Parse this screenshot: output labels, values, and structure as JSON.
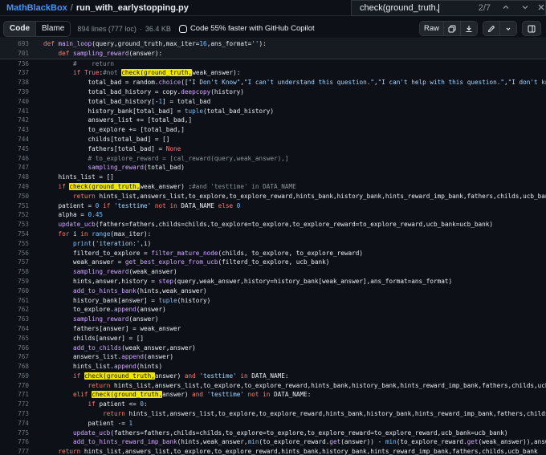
{
  "breadcrumb": {
    "repo": "MathBlackBox",
    "separator": "/",
    "file": "run_with_earlystopping.py"
  },
  "find": {
    "query": "check(ground_truth,",
    "count": "2/7"
  },
  "toolbar": {
    "code_tab": "Code",
    "blame_tab": "Blame",
    "lines_info": "894 lines (777 loc)",
    "dot": "·",
    "size": "36.4 KB",
    "copilot": "Code 55% faster with GitHub Copilot",
    "raw": "Raw"
  },
  "highlight": "check(ground_truth,",
  "sticky": [
    {
      "n": "693",
      "t": "def main_loop(query,ground_truth,max_iter=16,ans_format=''):"
    },
    {
      "n": "701",
      "t": "    def sampling_reward(answer):"
    }
  ],
  "lines": [
    {
      "n": "736",
      "t": "        #    return"
    },
    {
      "n": "737",
      "t": "        if True:#not check(ground_truth,weak_answer):"
    },
    {
      "n": "738",
      "t": "            total_bad = random.choice([\"I Don't Know\",\"I can't understand this question.\",\"I can't help with this question.\",\"I don't know how to solve"
    },
    {
      "n": "739",
      "t": "            total_bad_history = copy.deepcopy(history)"
    },
    {
      "n": "740",
      "t": "            total_bad_history[-1] = total_bad"
    },
    {
      "n": "741",
      "t": "            history_bank[total_bad] = tuple(total_bad_history)"
    },
    {
      "n": "742",
      "t": "            answers_list += [total_bad,]"
    },
    {
      "n": "743",
      "t": "            to_explore += [total_bad,]"
    },
    {
      "n": "744",
      "t": "            childs[total_bad] = []"
    },
    {
      "n": "745",
      "t": "            fathers[total_bad] = None"
    },
    {
      "n": "746",
      "t": "            # to_explore_reward = [cal_reward(query,weak_answer),]"
    },
    {
      "n": "747",
      "t": "            sampling_reward(total_bad)"
    },
    {
      "n": "748",
      "t": "    hints_list = []"
    },
    {
      "n": "749",
      "t": "    if check(ground_truth,weak_answer) :#and 'testtime' in DATA_NAME"
    },
    {
      "n": "750",
      "t": "        return hints_list,answers_list,to_explore,to_explore_reward,hints_bank,history_bank,hints_reward_imp_bank,fathers,childs,ucb_bank"
    },
    {
      "n": "751",
      "t": "    patient = 0 if 'testtime' not in DATA_NAME else 0"
    },
    {
      "n": "752",
      "t": "    alpha = 0.45"
    },
    {
      "n": "753",
      "t": "    update_ucb(fathers=fathers,childs=childs,to_explore=to_explore,to_explore_reward=to_explore_reward,ucb_bank=ucb_bank)"
    },
    {
      "n": "754",
      "t": "    for i in range(max_iter):"
    },
    {
      "n": "755",
      "t": "        print('iteration:',i)"
    },
    {
      "n": "756",
      "t": "        filterd_to_explore = filter_mature_node(childs, to_explore, to_explore_reward)"
    },
    {
      "n": "757",
      "t": "        weak_answer = get_best_explore_from_ucb(filterd_to_explore, ucb_bank)"
    },
    {
      "n": "758",
      "t": "        sampling_reward(weak_answer)"
    },
    {
      "n": "759",
      "t": "        hints,answer,history = step(query,weak_answer,history=history_bank[weak_answer],ans_format=ans_format)"
    },
    {
      "n": "760",
      "t": "        add_to_hints_bank(hints,weak_answer)"
    },
    {
      "n": "761",
      "t": "        history_bank[answer] = tuple(history)"
    },
    {
      "n": "762",
      "t": "        to_explore.append(answer)"
    },
    {
      "n": "763",
      "t": "        sampling_reward(answer)"
    },
    {
      "n": "764",
      "t": "        fathers[answer] = weak_answer"
    },
    {
      "n": "765",
      "t": "        childs[answer] = []"
    },
    {
      "n": "766",
      "t": "        add_to_childs(weak_answer,answer)"
    },
    {
      "n": "767",
      "t": "        answers_list.append(answer)"
    },
    {
      "n": "768",
      "t": "        hints_list.append(hints)"
    },
    {
      "n": "769",
      "t": "        if check(ground_truth,answer) and 'testtime' in DATA_NAME:"
    },
    {
      "n": "770",
      "t": "            return hints_list,answers_list,to_explore,to_explore_reward,hints_bank,history_bank,hints_reward_imp_bank,fathers,childs,ucb_bank"
    },
    {
      "n": "771",
      "t": "        elif check(ground_truth,answer) and 'testtime' not in DATA_NAME:"
    },
    {
      "n": "772",
      "t": "            if patient <= 0:"
    },
    {
      "n": "773",
      "t": "                return hints_list,answers_list,to_explore,to_explore_reward,hints_bank,history_bank,hints_reward_imp_bank,fathers,childs,ucb_bank"
    },
    {
      "n": "774",
      "t": "            patient -= 1"
    },
    {
      "n": "775",
      "t": "        update_ucb(fathers=fathers,childs=childs,to_explore=to_explore,to_explore_reward=to_explore_reward,ucb_bank=ucb_bank)"
    },
    {
      "n": "776",
      "t": "        add_to_hints_reward_imp_bank(hints,weak_answer,min(to_explore_reward.get(answer)) - min(to_explore_reward.get(weak_answer)),answer)#ucb_ban"
    },
    {
      "n": "777",
      "t": "    return hints_list,answers_list,to_explore,to_explore_reward,hints_bank,history_bank,hints_reward_imp_bank,fathers,childs,ucb_bank"
    }
  ],
  "colors": {
    "background": "#0d1117",
    "keyword": "#ff7b72",
    "function": "#d2a8ff",
    "string": "#a5d6ff",
    "number": "#79c0ff",
    "comment": "#8b949e",
    "highlight": "#f2e600",
    "link": "#4493f8"
  },
  "icons": [
    "copy-icon",
    "download-icon",
    "pencil-icon",
    "chevron-down-icon",
    "chevron-up-icon",
    "close-icon",
    "symbols-panel-icon",
    "copilot-icon"
  ]
}
